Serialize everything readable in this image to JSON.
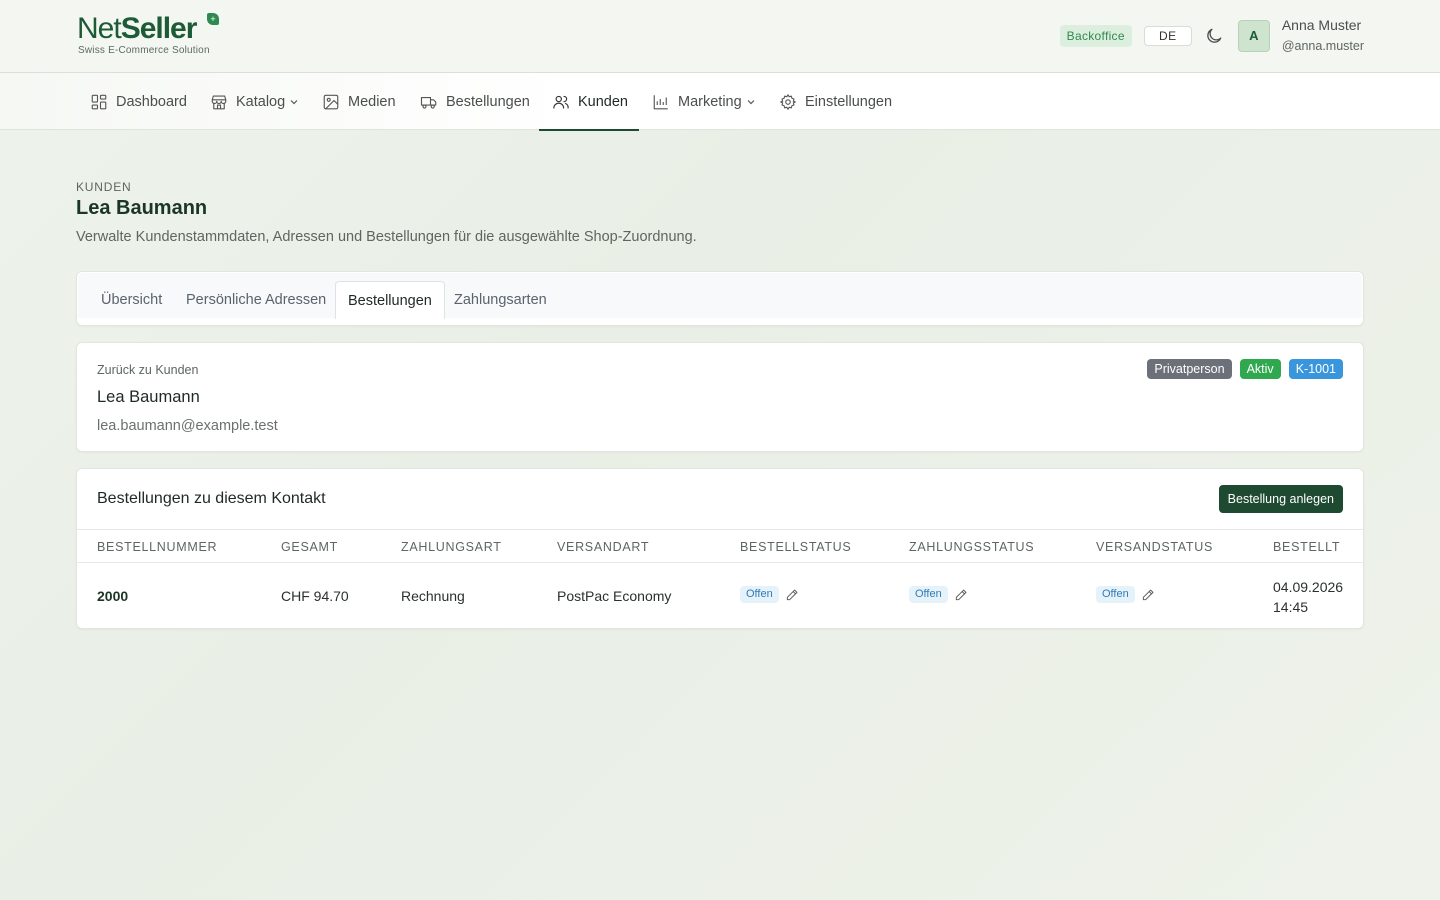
{
  "brand": {
    "name_part1": "Net",
    "name_part2": "Seller",
    "tagline": "Swiss E-Commerce Solution"
  },
  "header": {
    "env_badge": "Backoffice",
    "language": "DE",
    "user": {
      "initial": "A",
      "name": "Anna Muster",
      "handle": "@anna.muster"
    }
  },
  "nav": {
    "items": [
      {
        "label": "Dashboard",
        "icon": "dashboard-icon"
      },
      {
        "label": "Katalog",
        "icon": "store-icon",
        "has_dropdown": true
      },
      {
        "label": "Medien",
        "icon": "image-icon"
      },
      {
        "label": "Bestellungen",
        "icon": "truck-icon"
      },
      {
        "label": "Kunden",
        "icon": "users-icon",
        "active": true
      },
      {
        "label": "Marketing",
        "icon": "chart-icon",
        "has_dropdown": true
      },
      {
        "label": "Einstellungen",
        "icon": "gear-icon"
      }
    ]
  },
  "page": {
    "eyebrow": "KUNDEN",
    "title": "Lea Baumann",
    "description": "Verwalte Kundenstammdaten, Adressen und Bestellungen für die ausgewählte Shop-Zuordnung."
  },
  "tabs": [
    {
      "label": "Übersicht"
    },
    {
      "label": "Persönliche Adressen"
    },
    {
      "label": "Bestellungen",
      "active": true
    },
    {
      "label": "Zahlungsarten"
    }
  ],
  "customer": {
    "back_label": "Zurück zu Kunden",
    "name": "Lea Baumann",
    "email": "lea.baumann@example.test",
    "badges": [
      {
        "label": "Privatperson",
        "color": "#6b7079"
      },
      {
        "label": "Aktiv",
        "color": "#2fa84f"
      },
      {
        "label": "K-1001",
        "color": "#3a96dc"
      }
    ]
  },
  "orders": {
    "title": "Bestellungen zu diesem Kontakt",
    "create_label": "Bestellung anlegen",
    "columns": [
      "BESTELLNUMMER",
      "GESAMT",
      "ZAHLUNGSART",
      "VERSANDART",
      "BESTELLSTATUS",
      "ZAHLUNGSSTATUS",
      "VERSANDSTATUS",
      "BESTELLT"
    ],
    "rows": [
      {
        "number": "2000",
        "total": "CHF 94.70",
        "payment_method": "Rechnung",
        "shipping_method": "PostPac Economy",
        "order_status": "Offen",
        "payment_status": "Offen",
        "shipping_status": "Offen",
        "date": "04.09.2026",
        "time": "14:45"
      }
    ]
  },
  "colors": {
    "brand_green": "#1d4a30",
    "accent_green": "#2f8a4f",
    "status_blue": "#2f7bb6"
  }
}
